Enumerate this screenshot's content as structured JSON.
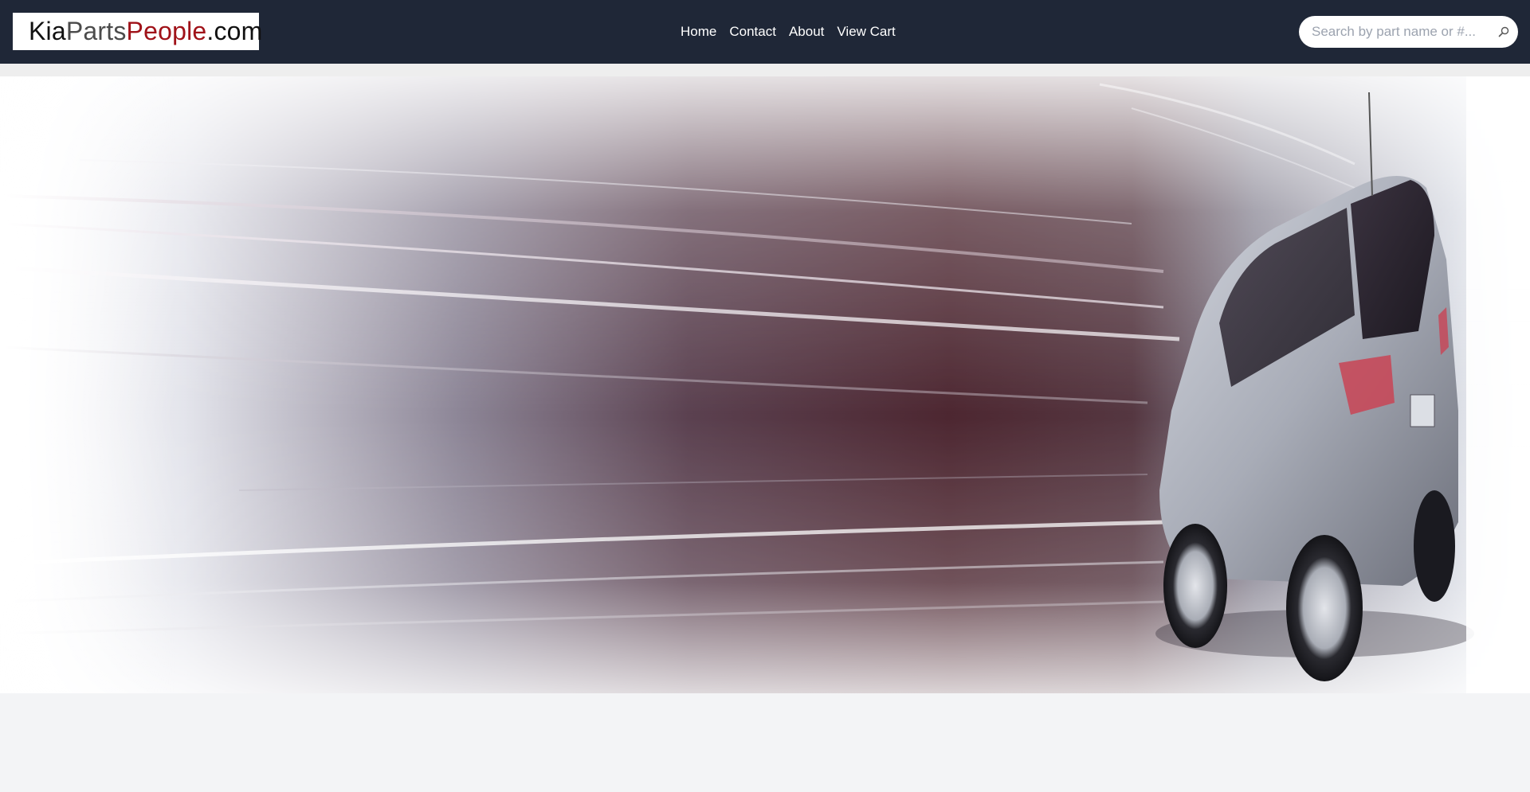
{
  "logo": {
    "part1": "Kia",
    "part2": "Parts",
    "part3": "People",
    "part4": ".com"
  },
  "nav": {
    "items": [
      {
        "label": "Home"
      },
      {
        "label": "Contact"
      },
      {
        "label": "About"
      },
      {
        "label": "View Cart"
      }
    ]
  },
  "search": {
    "placeholder": "Search by part name or #...",
    "value": "",
    "icon": "search-icon"
  },
  "colors": {
    "navbar_bg": "#1f2737",
    "brand_red": "#a01219",
    "page_bg": "#f3f4f6"
  },
  "hero": {
    "image": "kia-suv-motion-banner"
  }
}
